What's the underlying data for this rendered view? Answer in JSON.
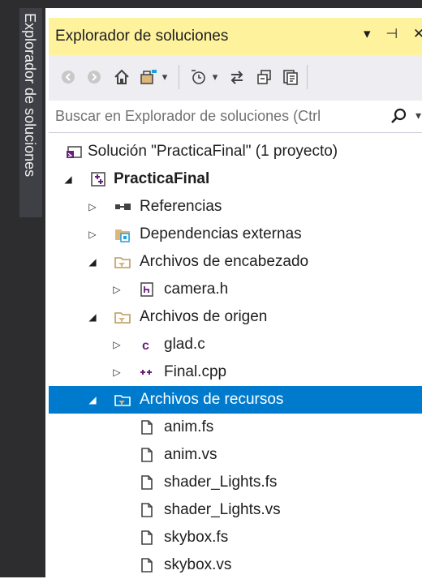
{
  "side_tab": {
    "label": "Explorador de soluciones"
  },
  "panel": {
    "title": "Explorador de soluciones",
    "title_controls": [
      "▾",
      "⊣",
      "✕"
    ]
  },
  "search": {
    "placeholder": "Buscar en Explorador de soluciones (Ctrl"
  },
  "tree": {
    "solution": "Solución \"PracticaFinal\"  (1 proyecto)",
    "project": "PracticaFinal",
    "items": [
      {
        "label": "Referencias",
        "icon": "references-icon"
      },
      {
        "label": "Dependencias externas",
        "icon": "external-deps-icon"
      },
      {
        "label": "Archivos de encabezado",
        "icon": "filter-folder-icon"
      },
      {
        "label": "camera.h",
        "icon": "header-file-icon"
      },
      {
        "label": "Archivos de origen",
        "icon": "filter-folder-icon"
      },
      {
        "label": "glad.c",
        "icon": "c-file-icon"
      },
      {
        "label": "Final.cpp",
        "icon": "cpp-file-icon"
      },
      {
        "label": "Archivos de recursos",
        "icon": "filter-folder-icon",
        "selected": true
      },
      {
        "label": "anim.fs",
        "icon": "file-icon"
      },
      {
        "label": "anim.vs",
        "icon": "file-icon"
      },
      {
        "label": "shader_Lights.fs",
        "icon": "file-icon"
      },
      {
        "label": "shader_Lights.vs",
        "icon": "file-icon"
      },
      {
        "label": "skybox.fs",
        "icon": "file-icon"
      },
      {
        "label": "skybox.vs",
        "icon": "file-icon"
      }
    ]
  },
  "colors": {
    "title_bar": "#fff29d",
    "selection": "#007acc",
    "frame": "#2d2d30",
    "toolbar": "#eeeef2"
  }
}
